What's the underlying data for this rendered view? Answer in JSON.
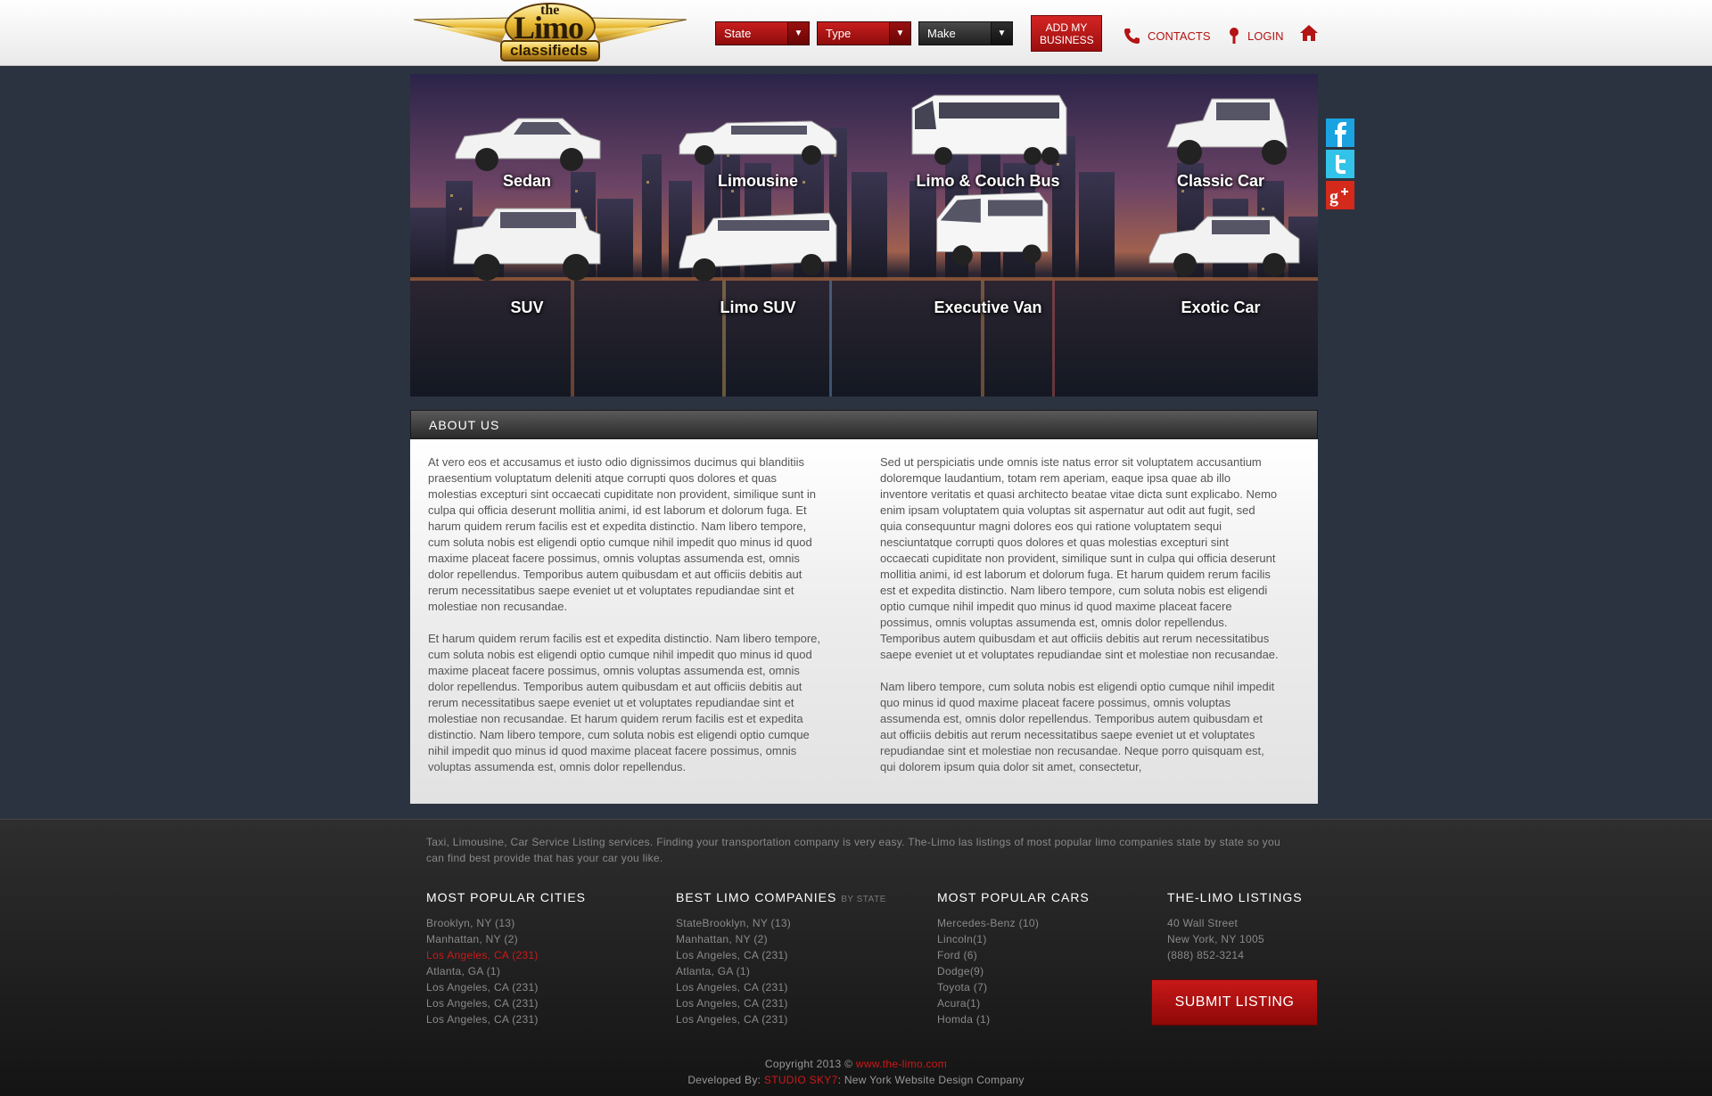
{
  "header": {
    "logo": {
      "the": "the",
      "limo": "Limo",
      "classifieds": "classifieds"
    },
    "filters": [
      {
        "label": "State",
        "style": "red"
      },
      {
        "label": "Type",
        "style": "red"
      },
      {
        "label": "Make",
        "style": "dark"
      }
    ],
    "add_business": "ADD MY BUSINESS",
    "contacts": "CONTACTS",
    "login": "LOGIN",
    "icons": {
      "contacts": "phone-icon",
      "login": "pin-icon",
      "home": "home-icon"
    }
  },
  "hero": {
    "categories": [
      {
        "label": "Sedan"
      },
      {
        "label": "Limousine"
      },
      {
        "label": "Limo & Couch Bus"
      },
      {
        "label": "Classic Car"
      },
      {
        "label": "SUV"
      },
      {
        "label": "Limo SUV"
      },
      {
        "label": "Executive Van"
      },
      {
        "label": "Exotic Car"
      }
    ]
  },
  "social": [
    "facebook-icon",
    "twitter-icon",
    "google-plus-icon"
  ],
  "about": {
    "title": "ABOUT US",
    "left": [
      "At vero eos et accusamus et iusto odio dignissimos ducimus qui blanditiis praesentium voluptatum deleniti atque corrupti quos dolores et quas molestias excepturi sint occaecati cupiditate non provident, similique sunt in culpa qui officia deserunt mollitia animi, id est laborum et dolorum fuga. Et harum quidem rerum facilis est et expedita distinctio. Nam libero tempore, cum soluta nobis est eligendi optio cumque nihil impedit quo minus id quod maxime placeat facere possimus, omnis voluptas assumenda est, omnis dolor repellendus. Temporibus autem quibusdam et aut officiis debitis aut rerum necessitatibus saepe eveniet ut et voluptates repudiandae sint et molestiae non recusandae.",
      "Et harum quidem rerum facilis est et expedita distinctio. Nam libero tempore, cum soluta nobis est eligendi optio cumque nihil impedit quo minus id quod maxime placeat facere possimus, omnis voluptas assumenda est, omnis dolor repellendus. Temporibus autem quibusdam et aut officiis debitis aut rerum necessitatibus saepe eveniet ut et voluptates repudiandae sint et molestiae non recusandae.  Et harum quidem rerum facilis est et expedita distinctio. Nam libero tempore, cum soluta nobis est eligendi optio cumque nihil impedit quo minus id quod maxime placeat facere possimus, omnis voluptas assumenda est, omnis dolor repellendus."
    ],
    "right": [
      "Sed ut perspiciatis unde omnis iste natus error sit voluptatem accusantium doloremque laudantium, totam rem aperiam, eaque ipsa quae ab illo inventore veritatis et quasi architecto beatae vitae dicta sunt explicabo. Nemo enim ipsam voluptatem quia voluptas sit aspernatur aut odit aut fugit, sed quia consequuntur magni dolores eos qui ratione voluptatem sequi nesciuntatque corrupti quos dolores et quas molestias excepturi sint occaecati cupiditate non provident, similique sunt in culpa qui officia deserunt mollitia animi, id est laborum et dolorum fuga. Et harum quidem rerum facilis est et expedita distinctio. Nam libero tempore, cum soluta nobis est eligendi optio cumque nihil impedit quo minus id quod maxime placeat facere possimus, omnis voluptas assumenda est, omnis dolor repellendus. Temporibus autem quibusdam et aut officiis debitis aut rerum necessitatibus saepe eveniet ut et voluptates repudiandae sint et molestiae non recusandae.",
      "Nam libero tempore, cum soluta nobis est eligendi optio cumque nihil impedit quo minus id quod maxime placeat facere possimus, omnis voluptas assumenda est, omnis dolor repellendus. Temporibus autem quibusdam et aut officiis debitis aut rerum necessitatibus saepe eveniet ut et voluptates repudiandae sint et molestiae non recusandae. Neque porro quisquam est, qui dolorem ipsum quia dolor sit amet, consectetur,"
    ]
  },
  "footer": {
    "intro": "Taxi, Limousine, Car Service Listing services. Finding your transportation company is very easy. The-Limo las listings of most popular limo companies state by state so you can find best provide that has your car you like.",
    "columns": {
      "cities": {
        "title": "MOST POPULAR CITIES",
        "items": [
          "Brooklyn, NY (13)",
          "Manhattan, NY (2)",
          "Los Angeles, CA (231)",
          "Atlanta, GA (1)",
          "Los Angeles, CA (231)",
          "Los Angeles, CA (231)",
          "Los Angeles, CA (231)"
        ]
      },
      "companies": {
        "title": "BEST LIMO COMPANIES",
        "subtitle": "BY STATE",
        "items": [
          "StateBrooklyn, NY (13)",
          "Manhattan, NY (2)",
          "Los Angeles, CA (231)",
          "Atlanta, GA (1)",
          "Los Angeles, CA (231)",
          "Los Angeles, CA (231)",
          "Los Angeles, CA (231)"
        ]
      },
      "cars": {
        "title": "MOST POPULAR CARS",
        "items": [
          "Mercedes-Benz (10)",
          "Lincoln(1)",
          "Ford (6)",
          "Dodge(9)",
          "Toyota (7)",
          "Acura(1)",
          "Homda (1)"
        ]
      },
      "listings": {
        "title": "THE-LIMO LISTINGS",
        "items": [
          "40 Wall Street",
          "New York, NY 1005",
          "(888) 852-3214"
        ]
      }
    },
    "submit": "SUBMIT LISTING",
    "copyright": {
      "prefix": "Copyright 2013 © ",
      "link": "www.the-limo.com"
    },
    "developed": {
      "prefix": "Developed By: ",
      "link": "STUDIO SKY7",
      "suffix": ": New York Website Design Company"
    }
  },
  "colors": {
    "accent": "#c81e1e",
    "page_bg": "#2c3340",
    "footer_bg": "#1c1c1c"
  }
}
